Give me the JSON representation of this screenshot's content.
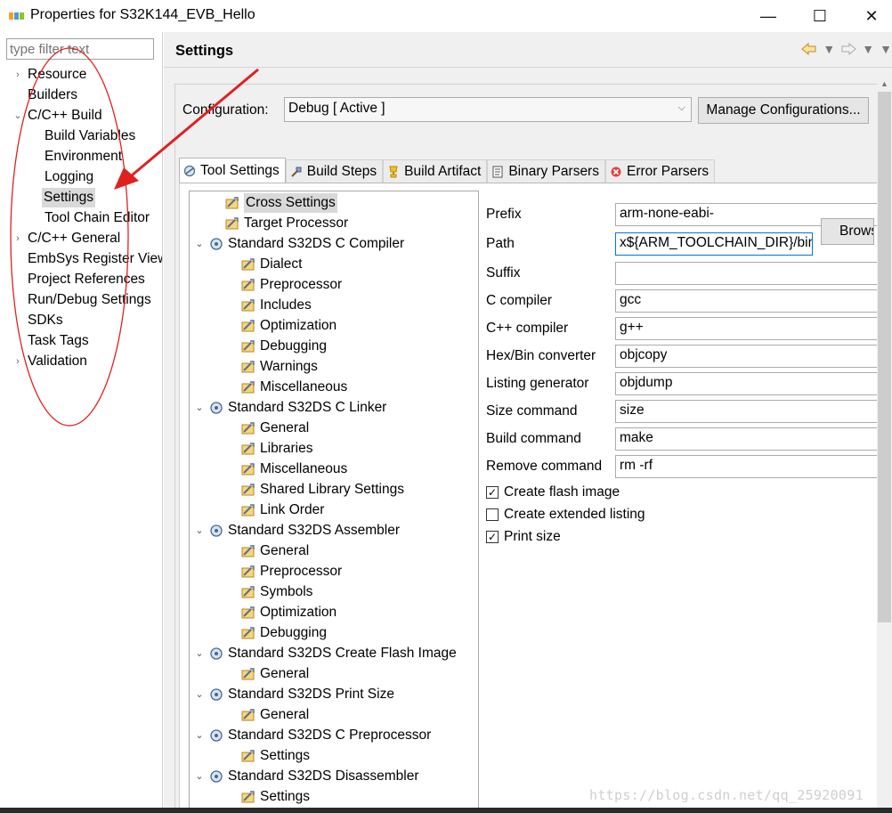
{
  "window": {
    "title": "Properties for S32K144_EVB_Hello",
    "minimize": "—",
    "maximize": "☐",
    "close": "✕"
  },
  "filter": {
    "placeholder": "type filter text"
  },
  "nav": {
    "items": [
      {
        "label": "Resource",
        "toggle": "›"
      },
      {
        "label": "Builders",
        "toggle": ""
      },
      {
        "label": "C/C++ Build",
        "toggle": "⌄"
      },
      {
        "label": "Build Variables",
        "toggle": ""
      },
      {
        "label": "Environment",
        "toggle": ""
      },
      {
        "label": "Logging",
        "toggle": ""
      },
      {
        "label": "Settings",
        "toggle": ""
      },
      {
        "label": "Tool Chain Editor",
        "toggle": ""
      },
      {
        "label": "C/C++ General",
        "toggle": "›"
      },
      {
        "label": "EmbSys Register View",
        "toggle": ""
      },
      {
        "label": "Project References",
        "toggle": ""
      },
      {
        "label": "Run/Debug Settings",
        "toggle": ""
      },
      {
        "label": "SDKs",
        "toggle": ""
      },
      {
        "label": "Task Tags",
        "toggle": ""
      },
      {
        "label": "Validation",
        "toggle": "›"
      }
    ]
  },
  "header": {
    "title": "Settings"
  },
  "config": {
    "label": "Configuration:",
    "value": "Debug  [ Active ]",
    "manage_label": "Manage Configurations..."
  },
  "tabs": [
    {
      "label": "Tool Settings"
    },
    {
      "label": "Build Steps"
    },
    {
      "label": "Build Artifact"
    },
    {
      "label": "Binary Parsers"
    },
    {
      "label": "Error Parsers"
    }
  ],
  "tree": [
    {
      "label": "Cross Settings",
      "level": 1,
      "toggle": ""
    },
    {
      "label": "Target Processor",
      "level": 1,
      "toggle": ""
    },
    {
      "label": "Standard S32DS C Compiler",
      "level": 0,
      "toggle": "⌄"
    },
    {
      "label": "Dialect",
      "level": 2,
      "toggle": ""
    },
    {
      "label": "Preprocessor",
      "level": 2,
      "toggle": ""
    },
    {
      "label": "Includes",
      "level": 2,
      "toggle": ""
    },
    {
      "label": "Optimization",
      "level": 2,
      "toggle": ""
    },
    {
      "label": "Debugging",
      "level": 2,
      "toggle": ""
    },
    {
      "label": "Warnings",
      "level": 2,
      "toggle": ""
    },
    {
      "label": "Miscellaneous",
      "level": 2,
      "toggle": ""
    },
    {
      "label": "Standard S32DS C Linker",
      "level": 0,
      "toggle": "⌄"
    },
    {
      "label": "General",
      "level": 2,
      "toggle": ""
    },
    {
      "label": "Libraries",
      "level": 2,
      "toggle": ""
    },
    {
      "label": "Miscellaneous",
      "level": 2,
      "toggle": ""
    },
    {
      "label": "Shared Library Settings",
      "level": 2,
      "toggle": ""
    },
    {
      "label": "Link Order",
      "level": 2,
      "toggle": ""
    },
    {
      "label": "Standard S32DS Assembler",
      "level": 0,
      "toggle": "⌄"
    },
    {
      "label": "General",
      "level": 2,
      "toggle": ""
    },
    {
      "label": "Preprocessor",
      "level": 2,
      "toggle": ""
    },
    {
      "label": "Symbols",
      "level": 2,
      "toggle": ""
    },
    {
      "label": "Optimization",
      "level": 2,
      "toggle": ""
    },
    {
      "label": "Debugging",
      "level": 2,
      "toggle": ""
    },
    {
      "label": "Standard S32DS Create Flash Image",
      "level": 0,
      "toggle": "⌄"
    },
    {
      "label": "General",
      "level": 2,
      "toggle": ""
    },
    {
      "label": "Standard S32DS Print Size",
      "level": 0,
      "toggle": "⌄"
    },
    {
      "label": "General",
      "level": 2,
      "toggle": ""
    },
    {
      "label": "Standard S32DS C Preprocessor",
      "level": 0,
      "toggle": "⌄"
    },
    {
      "label": "Settings",
      "level": 2,
      "toggle": ""
    },
    {
      "label": "Standard S32DS Disassembler",
      "level": 0,
      "toggle": "⌄"
    },
    {
      "label": "Settings",
      "level": 2,
      "toggle": ""
    }
  ],
  "form": {
    "fields": [
      {
        "label": "Prefix",
        "value": "arm-none-eabi-"
      },
      {
        "label": "Path",
        "value": "x${ARM_TOOLCHAIN_DIR}/bin"
      },
      {
        "label": "Suffix",
        "value": ""
      },
      {
        "label": "C compiler",
        "value": "gcc"
      },
      {
        "label": "C++ compiler",
        "value": "g++"
      },
      {
        "label": "Hex/Bin converter",
        "value": "objcopy"
      },
      {
        "label": "Listing generator",
        "value": "objdump"
      },
      {
        "label": "Size command",
        "value": "size"
      },
      {
        "label": "Build command",
        "value": "make"
      },
      {
        "label": "Remove command",
        "value": "rm -rf"
      }
    ],
    "browse_label": "Browse...",
    "checks": [
      {
        "label": "Create flash image",
        "checked": true,
        "mark": "✓"
      },
      {
        "label": "Create extended listing",
        "checked": false,
        "mark": ""
      },
      {
        "label": "Print size",
        "checked": true,
        "mark": "✓"
      }
    ]
  },
  "watermark": "https://blog.csdn.net/qq_25920091",
  "colors": {
    "annotation": "#e02020",
    "selection": "#d9d9d9",
    "input_focus": "#0078d7"
  }
}
